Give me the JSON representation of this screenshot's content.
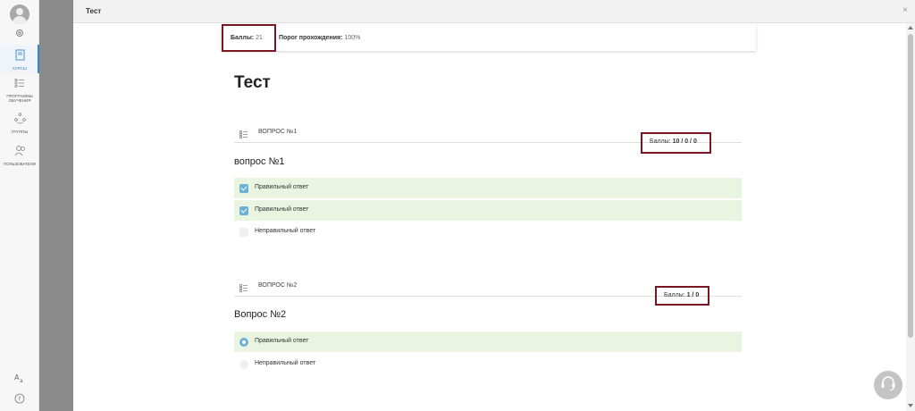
{
  "sidebar": {
    "items": [
      {
        "label": "курсы",
        "icon": "book-icon",
        "active": true
      },
      {
        "label": "программы обучения",
        "icon": "list-icon",
        "active": false
      },
      {
        "label": "группы",
        "icon": "group-icon",
        "active": false
      },
      {
        "label": "пользователи",
        "icon": "users-icon",
        "active": false
      }
    ],
    "bottom_icons": [
      "translate-icon",
      "help-icon"
    ]
  },
  "modal": {
    "title": "Тест",
    "close_symbol": "×"
  },
  "score_bar": {
    "points_label": "Баллы:",
    "points_value": "21",
    "threshold_label": "Порог прохождения:",
    "threshold_value": "100%"
  },
  "test_title": "Тест",
  "questions": [
    {
      "label": "ВОПРОС №1",
      "points_label": "Баллы:",
      "points_value": "10 / 0 / 0",
      "text": "вопрос №1",
      "answers": [
        {
          "text": "Правильный ответ",
          "correct": true
        },
        {
          "text": "Правильный ответ",
          "correct": true
        },
        {
          "text": "Неправильный ответ",
          "correct": false
        }
      ]
    },
    {
      "label": "ВОПРОС №2",
      "points_label": "Баллы:",
      "points_value": "1 / 0",
      "text": "Вопрос №2",
      "answers": [
        {
          "text": "Правильный ответ",
          "correct": true
        },
        {
          "text": "Неправильный ответ",
          "correct": false
        }
      ]
    }
  ],
  "colors": {
    "highlight_border": "#7a1522",
    "correct_bg": "#eaf5e1",
    "accent": "#6db0d6",
    "sidebar_active": "#3a85c6"
  }
}
